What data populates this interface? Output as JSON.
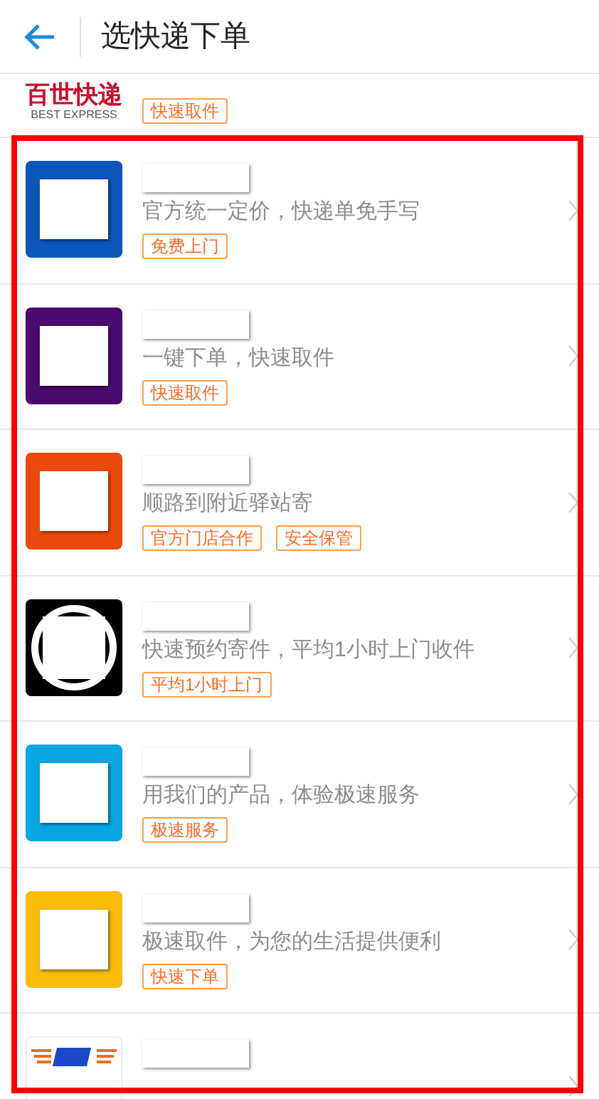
{
  "header": {
    "title": "选快递下单"
  },
  "partial_item": {
    "logo": {
      "kind": "best-express",
      "lines": [
        "百世快递",
        "BEST EXPRESS"
      ]
    },
    "tags": [
      "快速取件"
    ]
  },
  "items": [
    {
      "logo": {
        "kind": "redacted",
        "color": "#0a56b8"
      },
      "description": "官方统一定价，快递单免手写",
      "tags": [
        "免费上门"
      ]
    },
    {
      "logo": {
        "kind": "redacted",
        "color": "#4b0a6e"
      },
      "description": "一键下单，快速取件",
      "tags": [
        "快速取件"
      ]
    },
    {
      "logo": {
        "kind": "redacted",
        "color": "#eb4a0c"
      },
      "description": "顺路到附近驿站寄",
      "tags": [
        "官方门店合作",
        "安全保管"
      ]
    },
    {
      "logo": {
        "kind": "redacted-ring",
        "color": "#000000"
      },
      "description": "快速预约寄件，平均1小时上门收件",
      "tags": [
        "平均1小时上门"
      ]
    },
    {
      "logo": {
        "kind": "redacted",
        "color": "#0aa5e3"
      },
      "description": "用我们的产品，体验极速服务",
      "tags": [
        "极速服务"
      ]
    },
    {
      "logo": {
        "kind": "redacted",
        "color": "#f9bd0a"
      },
      "description": "极速取件，为您的生活提供便利",
      "tags": [
        "快速下单"
      ]
    },
    {
      "logo": {
        "kind": "ems"
      }
    }
  ]
}
